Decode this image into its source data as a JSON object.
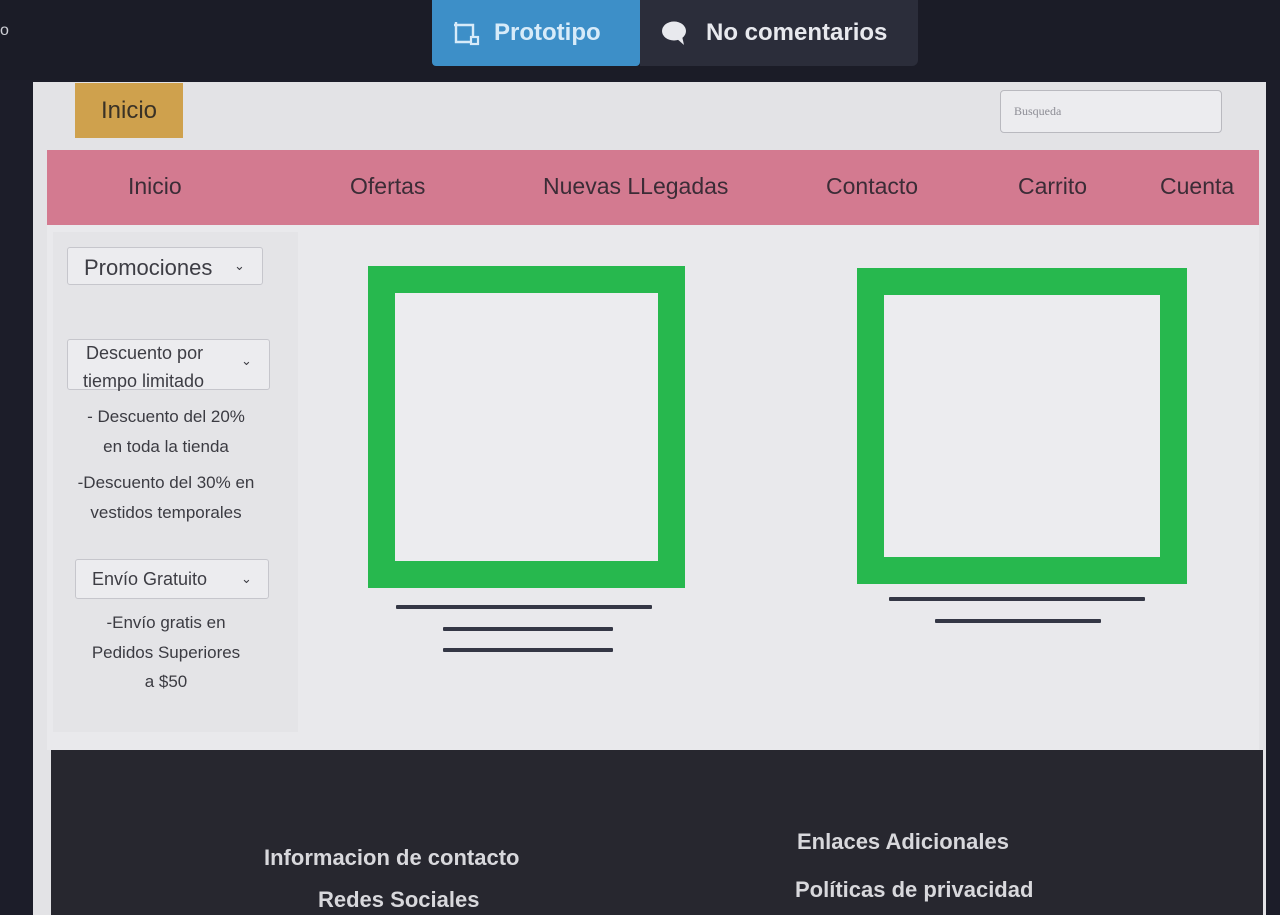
{
  "toolbar": {
    "prototype_label": "Prototipo",
    "comments_label": "No comentarios",
    "prototype_icon": "prototype-frame-icon",
    "comments_icon": "speech-bubble-icon"
  },
  "header": {
    "home_badge": "Inicio",
    "search_placeholder": "Busqueda"
  },
  "nav": {
    "items": [
      {
        "label": "Inicio"
      },
      {
        "label": "Ofertas"
      },
      {
        "label": "Nuevas LLegadas"
      },
      {
        "label": "Contacto"
      },
      {
        "label": "Carrito"
      },
      {
        "label": "Cuenta"
      }
    ],
    "color": "#d37a90"
  },
  "sidebar": {
    "promotions_label": "Promociones",
    "discount": {
      "label_line1": "Descuento por",
      "label_line2": "tiempo limitado",
      "details": [
        "- Descuento del 20%",
        "en toda la tienda",
        "-Descuento del 30% en",
        "vestidos temporales"
      ]
    },
    "shipping": {
      "label": "Envío Gratuito",
      "details": [
        "-Envío gratis en",
        "Pedidos  Superiores",
        "a $50"
      ]
    }
  },
  "products": {
    "frame_color": "#27b84e"
  },
  "footer": {
    "contact_info": "Informacion de contacto",
    "social": "Redes Sociales",
    "additional_links": "Enlaces Adicionales",
    "privacy": "Políticas de privacidad"
  }
}
